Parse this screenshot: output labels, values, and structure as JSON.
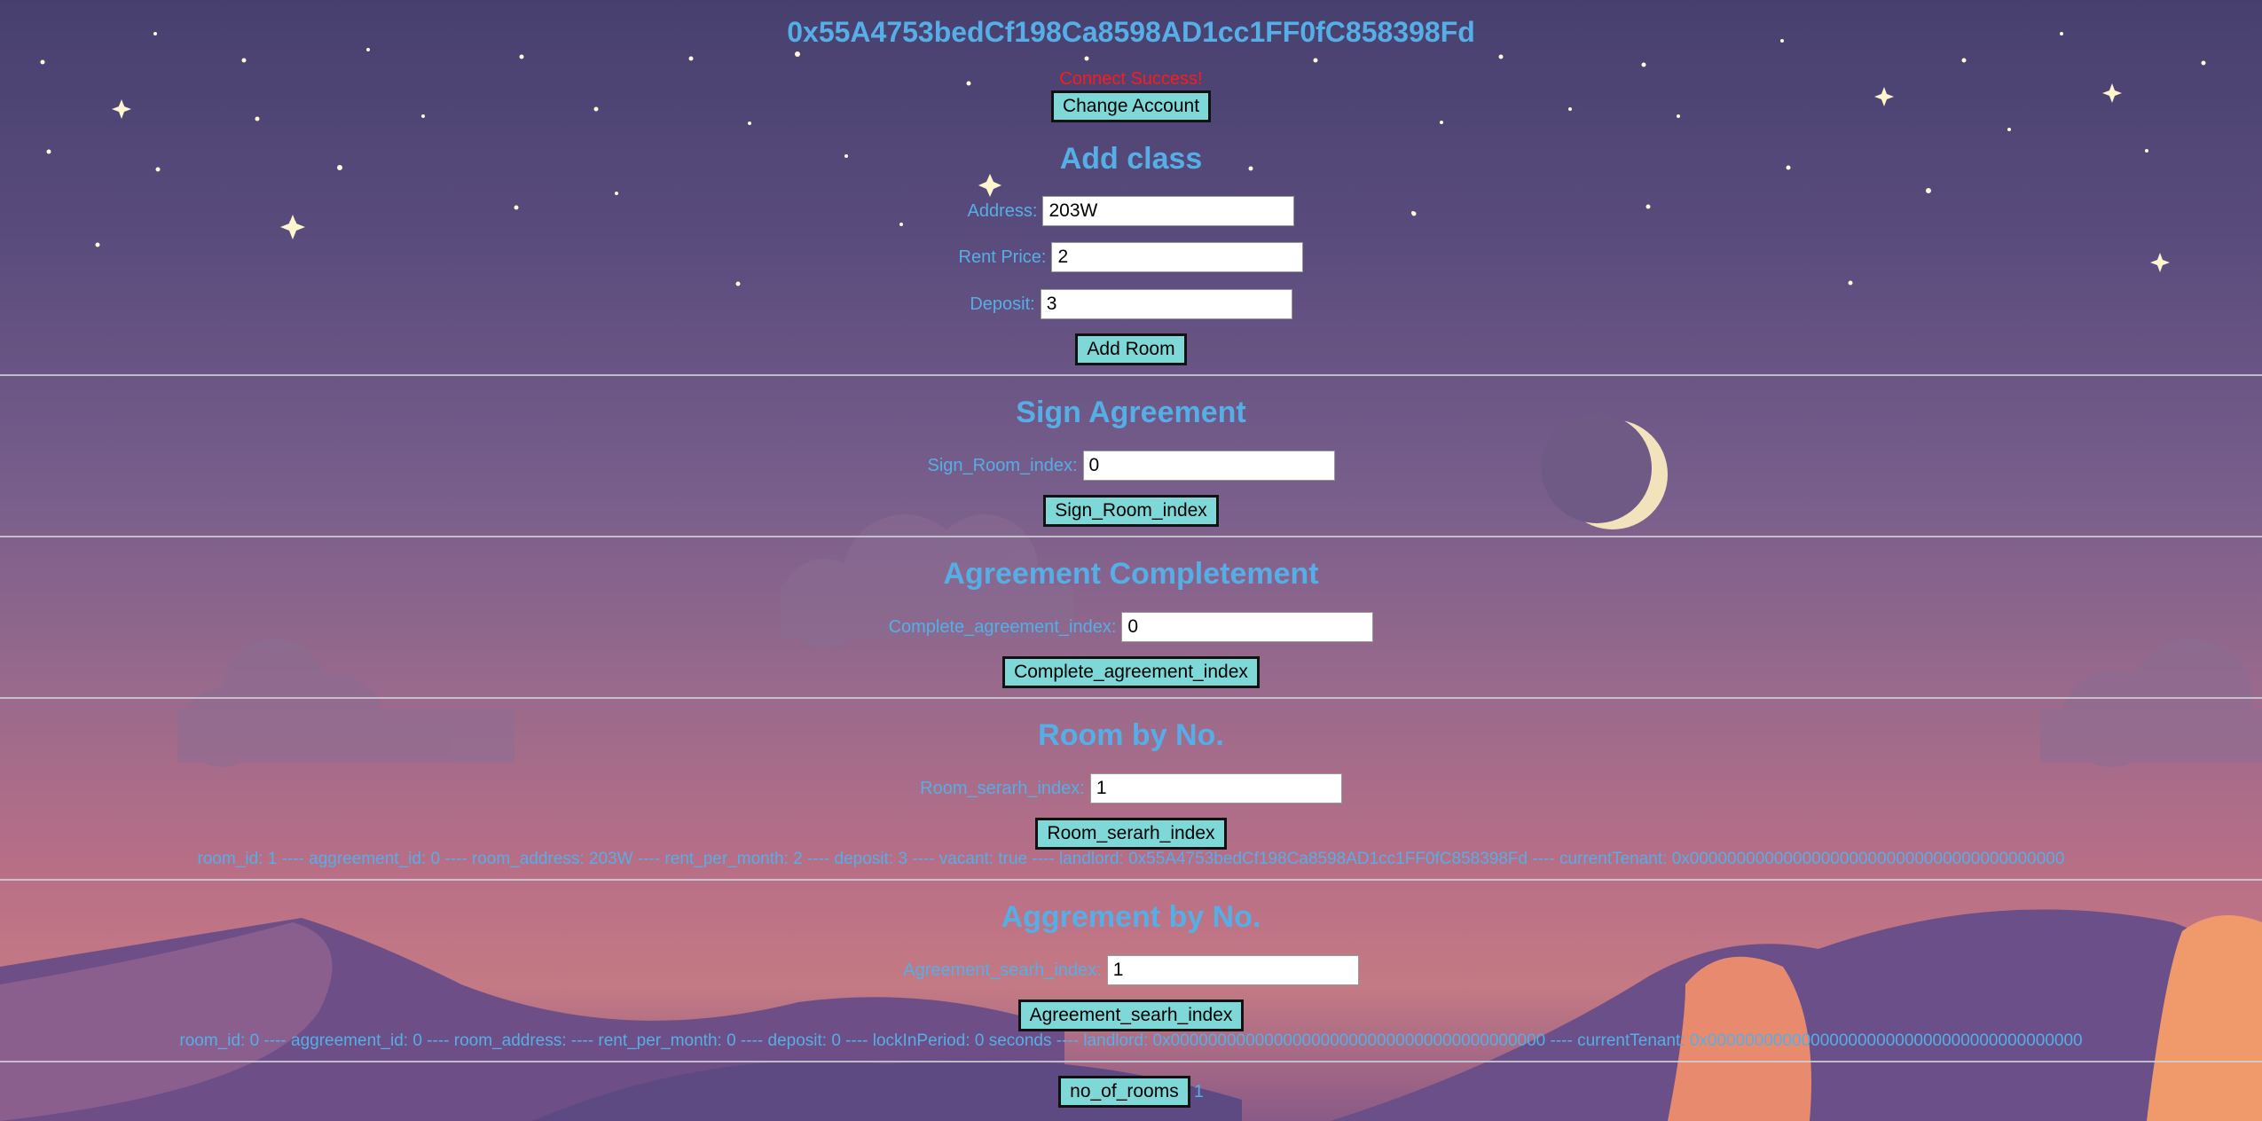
{
  "header": {
    "account_address": "0x55A4753bedCf198Ca8598AD1cc1FF0fC858398Fd",
    "status_text": "Connect Success!",
    "change_account_label": "Change Account"
  },
  "add_class": {
    "title": "Add class",
    "address_label": "Address:",
    "address_value": "203W",
    "rent_label": "Rent Price:",
    "rent_value": "2",
    "deposit_label": "Deposit:",
    "deposit_value": "3",
    "button_label": "Add Room"
  },
  "sign_agreement": {
    "title": "Sign Agreement",
    "field_label": "Sign_Room_index:",
    "field_value": "0",
    "button_label": "Sign_Room_index"
  },
  "agreement_completement": {
    "title": "Agreement Completement",
    "field_label": "Complete_agreement_index:",
    "field_value": "0",
    "button_label": "Complete_agreement_index"
  },
  "room_by_no": {
    "title": "Room by No.",
    "field_label": "Room_serarh_index:",
    "field_value": "1",
    "button_label": "Room_serarh_index",
    "result": "room_id: 1 ---- aggreement_id: 0 ---- room_address: 203W ---- rent_per_month: 2 ---- deposit: 3 ---- vacant: true ---- landlord: 0x55A4753bedCf198Ca8598AD1cc1FF0fC858398Fd ---- currentTenant: 0x0000000000000000000000000000000000000000"
  },
  "aggrement_by_no": {
    "title": "Aggrement by No.",
    "field_label": "Agreement_searh_index:",
    "field_value": "1",
    "button_label": "Agreement_searh_index",
    "result": "room_id: 0 ---- aggreement_id: 0 ---- room_address: ---- rent_per_month: 0 ---- deposit: 0 ---- lockInPeriod: 0 seconds ---- landlord: 0x0000000000000000000000000000000000000000 ---- currentTenant: 0x0000000000000000000000000000000000000000"
  },
  "footer": {
    "button_label": "no_of_rooms",
    "value": "1"
  },
  "colors": {
    "accent_text": "#56aee6",
    "button_bg": "#7fd8d8",
    "status_red": "#ff1a1a"
  }
}
